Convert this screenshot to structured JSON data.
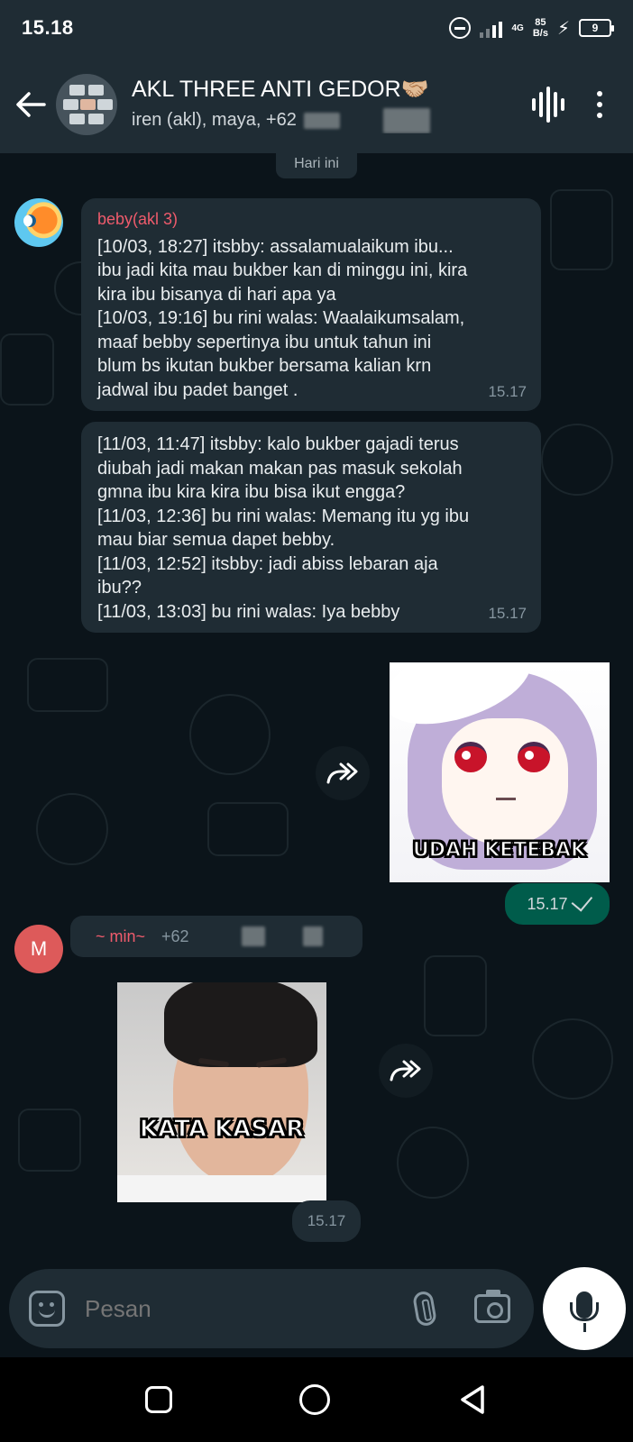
{
  "status_bar": {
    "time": "15.18",
    "network": "4G",
    "speed_value": "85",
    "speed_unit": "B/s",
    "battery": "9"
  },
  "header": {
    "title": "AKL THREE ANTI GEDOR🤝🏼",
    "subtitle": "iren (akl), maya, +62"
  },
  "chat": {
    "date_chip": "Hari ini",
    "messages": [
      {
        "sender": "beby(akl 3)",
        "lines": [
          "[10/03, 18:27] itsbby: assalamualaikum ibu...",
          "ibu jadi kita mau bukber kan di minggu ini, kira",
          "kira ibu bisanya di hari apa ya",
          "[10/03, 19:16] bu rini walas: Waalaikumsalam,",
          "maaf bebby sepertinya ibu untuk tahun ini",
          "blum bs ikutan bukber bersama kalian krn",
          "jadwal ibu padet banget ."
        ],
        "time": "15.17"
      },
      {
        "lines": [
          "[11/03, 11:47] itsbby: kalo bukber gajadi terus",
          "diubah jadi makan makan pas masuk sekolah",
          "gmna ibu kira kira ibu bisa ikut engga?",
          "[11/03, 12:36] bu rini walas: Memang itu yg ibu",
          "mau biar semua dapet bebby.",
          "[11/03, 12:52] itsbby: jadi abiss lebaran aja",
          "ibu??",
          "[11/03, 13:03] bu rini walas: Iya bebby"
        ],
        "time": "15.17"
      }
    ],
    "outgoing_sticker": {
      "caption": "UDAH KETEBAK",
      "time": "15.17"
    },
    "min_message": {
      "avatar_letter": "M",
      "sender": "~ min~",
      "phone": "+62",
      "sticker_caption": "KATA KASAR",
      "time": "15.17"
    }
  },
  "input": {
    "placeholder": "Pesan"
  },
  "colors": {
    "background": "#0b141a",
    "header": "#1f2c34",
    "incoming_bubble": "#1f2c34",
    "outgoing_bubble": "#005c4b",
    "sender_name": "#ef5b6c",
    "avatar_m": "#dd5a5a"
  }
}
